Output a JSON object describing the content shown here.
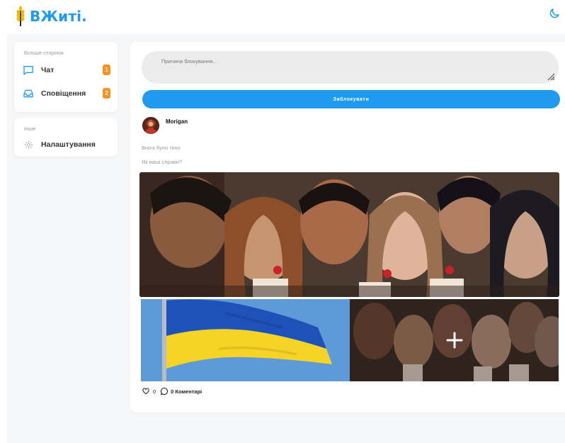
{
  "header": {
    "logo_text": "ВЖиті.",
    "logo_icon": "wheat-icon",
    "theme_toggle_icon": "moon-icon"
  },
  "sidebar": {
    "section1_title": "Більше сторінок",
    "items": [
      {
        "label": "Чат",
        "icon": "chat-icon",
        "badge": "1"
      },
      {
        "label": "Сповіщення",
        "icon": "inbox-icon",
        "badge": "2"
      }
    ],
    "section2_title": "Інше",
    "settings_label": "Налаштування",
    "settings_icon": "gear-icon"
  },
  "block_form": {
    "reason_placeholder": "Причина блокування...",
    "reason_value": "",
    "button_label": "Заблокувати"
  },
  "post": {
    "author": "Morigan",
    "lines": [
      "Вночі було тихо",
      "Як ваші справи?"
    ],
    "images": [
      "group-illustration",
      "ukrainian-flag",
      "group-illustration"
    ],
    "more_icon": "plus-icon",
    "likes": "0",
    "comments_label": "0 Коментарі"
  },
  "colors": {
    "accent": "#1e9bf0",
    "badge": "#f7931e"
  }
}
